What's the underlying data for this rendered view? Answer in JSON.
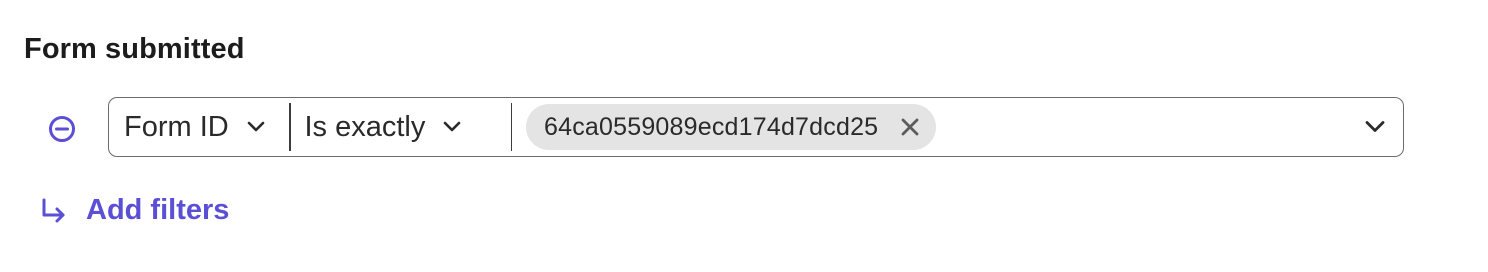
{
  "section": {
    "title": "Form submitted"
  },
  "filter": {
    "field_label": "Form ID",
    "operator_label": "Is exactly",
    "values": [
      {
        "label": "64ca0559089ecd174d7dcd25"
      }
    ]
  },
  "actions": {
    "add_filters_label": "Add filters"
  },
  "icons": {
    "remove_filter": "minus-circle-icon",
    "field_dropdown": "chevron-down-icon",
    "operator_dropdown": "chevron-down-icon",
    "chip_remove": "close-icon",
    "values_dropdown": "chevron-down-icon",
    "add_filters": "return-arrow-icon"
  },
  "colors": {
    "accent": "#5b4fd6",
    "chip_background": "#e4e4e4",
    "border": "#6b6b6b"
  }
}
